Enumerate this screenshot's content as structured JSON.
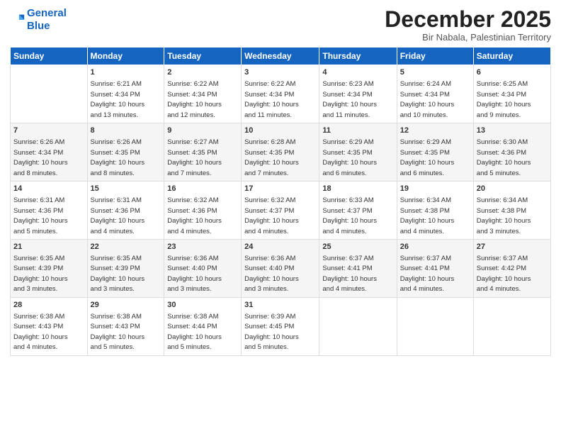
{
  "logo": {
    "line1": "General",
    "line2": "Blue"
  },
  "title": "December 2025",
  "location": "Bir Nabala, Palestinian Territory",
  "headers": [
    "Sunday",
    "Monday",
    "Tuesday",
    "Wednesday",
    "Thursday",
    "Friday",
    "Saturday"
  ],
  "weeks": [
    [
      {
        "day": "",
        "text": ""
      },
      {
        "day": "1",
        "text": "Sunrise: 6:21 AM\nSunset: 4:34 PM\nDaylight: 10 hours\nand 13 minutes."
      },
      {
        "day": "2",
        "text": "Sunrise: 6:22 AM\nSunset: 4:34 PM\nDaylight: 10 hours\nand 12 minutes."
      },
      {
        "day": "3",
        "text": "Sunrise: 6:22 AM\nSunset: 4:34 PM\nDaylight: 10 hours\nand 11 minutes."
      },
      {
        "day": "4",
        "text": "Sunrise: 6:23 AM\nSunset: 4:34 PM\nDaylight: 10 hours\nand 11 minutes."
      },
      {
        "day": "5",
        "text": "Sunrise: 6:24 AM\nSunset: 4:34 PM\nDaylight: 10 hours\nand 10 minutes."
      },
      {
        "day": "6",
        "text": "Sunrise: 6:25 AM\nSunset: 4:34 PM\nDaylight: 10 hours\nand 9 minutes."
      }
    ],
    [
      {
        "day": "7",
        "text": "Sunrise: 6:26 AM\nSunset: 4:34 PM\nDaylight: 10 hours\nand 8 minutes."
      },
      {
        "day": "8",
        "text": "Sunrise: 6:26 AM\nSunset: 4:35 PM\nDaylight: 10 hours\nand 8 minutes."
      },
      {
        "day": "9",
        "text": "Sunrise: 6:27 AM\nSunset: 4:35 PM\nDaylight: 10 hours\nand 7 minutes."
      },
      {
        "day": "10",
        "text": "Sunrise: 6:28 AM\nSunset: 4:35 PM\nDaylight: 10 hours\nand 7 minutes."
      },
      {
        "day": "11",
        "text": "Sunrise: 6:29 AM\nSunset: 4:35 PM\nDaylight: 10 hours\nand 6 minutes."
      },
      {
        "day": "12",
        "text": "Sunrise: 6:29 AM\nSunset: 4:35 PM\nDaylight: 10 hours\nand 6 minutes."
      },
      {
        "day": "13",
        "text": "Sunrise: 6:30 AM\nSunset: 4:36 PM\nDaylight: 10 hours\nand 5 minutes."
      }
    ],
    [
      {
        "day": "14",
        "text": "Sunrise: 6:31 AM\nSunset: 4:36 PM\nDaylight: 10 hours\nand 5 minutes."
      },
      {
        "day": "15",
        "text": "Sunrise: 6:31 AM\nSunset: 4:36 PM\nDaylight: 10 hours\nand 4 minutes."
      },
      {
        "day": "16",
        "text": "Sunrise: 6:32 AM\nSunset: 4:36 PM\nDaylight: 10 hours\nand 4 minutes."
      },
      {
        "day": "17",
        "text": "Sunrise: 6:32 AM\nSunset: 4:37 PM\nDaylight: 10 hours\nand 4 minutes."
      },
      {
        "day": "18",
        "text": "Sunrise: 6:33 AM\nSunset: 4:37 PM\nDaylight: 10 hours\nand 4 minutes."
      },
      {
        "day": "19",
        "text": "Sunrise: 6:34 AM\nSunset: 4:38 PM\nDaylight: 10 hours\nand 4 minutes."
      },
      {
        "day": "20",
        "text": "Sunrise: 6:34 AM\nSunset: 4:38 PM\nDaylight: 10 hours\nand 3 minutes."
      }
    ],
    [
      {
        "day": "21",
        "text": "Sunrise: 6:35 AM\nSunset: 4:39 PM\nDaylight: 10 hours\nand 3 minutes."
      },
      {
        "day": "22",
        "text": "Sunrise: 6:35 AM\nSunset: 4:39 PM\nDaylight: 10 hours\nand 3 minutes."
      },
      {
        "day": "23",
        "text": "Sunrise: 6:36 AM\nSunset: 4:40 PM\nDaylight: 10 hours\nand 3 minutes."
      },
      {
        "day": "24",
        "text": "Sunrise: 6:36 AM\nSunset: 4:40 PM\nDaylight: 10 hours\nand 3 minutes."
      },
      {
        "day": "25",
        "text": "Sunrise: 6:37 AM\nSunset: 4:41 PM\nDaylight: 10 hours\nand 4 minutes."
      },
      {
        "day": "26",
        "text": "Sunrise: 6:37 AM\nSunset: 4:41 PM\nDaylight: 10 hours\nand 4 minutes."
      },
      {
        "day": "27",
        "text": "Sunrise: 6:37 AM\nSunset: 4:42 PM\nDaylight: 10 hours\nand 4 minutes."
      }
    ],
    [
      {
        "day": "28",
        "text": "Sunrise: 6:38 AM\nSunset: 4:43 PM\nDaylight: 10 hours\nand 4 minutes."
      },
      {
        "day": "29",
        "text": "Sunrise: 6:38 AM\nSunset: 4:43 PM\nDaylight: 10 hours\nand 5 minutes."
      },
      {
        "day": "30",
        "text": "Sunrise: 6:38 AM\nSunset: 4:44 PM\nDaylight: 10 hours\nand 5 minutes."
      },
      {
        "day": "31",
        "text": "Sunrise: 6:39 AM\nSunset: 4:45 PM\nDaylight: 10 hours\nand 5 minutes."
      },
      {
        "day": "",
        "text": ""
      },
      {
        "day": "",
        "text": ""
      },
      {
        "day": "",
        "text": ""
      }
    ]
  ]
}
